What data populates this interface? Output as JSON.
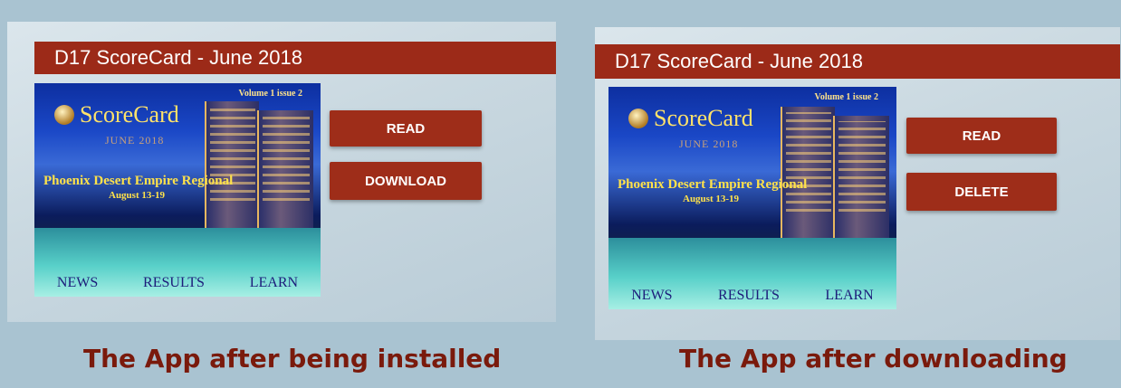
{
  "screens": [
    {
      "title": "D17 ScoreCard - June 2018",
      "buttons": [
        "READ",
        "DOWNLOAD"
      ],
      "caption": "The App after being installed"
    },
    {
      "title": "D17 ScoreCard - June 2018",
      "buttons": [
        "READ",
        "DELETE"
      ],
      "caption": "The App after downloading"
    }
  ],
  "cover": {
    "volume": "Volume 1 issue 2",
    "logo": "ScoreCard",
    "month": "JUNE 2018",
    "event": "Phoenix Desert Empire Regional",
    "dates": "August 13-19",
    "nav": [
      "NEWS",
      "RESULTS",
      "LEARN"
    ]
  },
  "colors": {
    "accent": "#9e2d19",
    "caption": "#7a1a0c",
    "background": "#a9c3d1"
  }
}
